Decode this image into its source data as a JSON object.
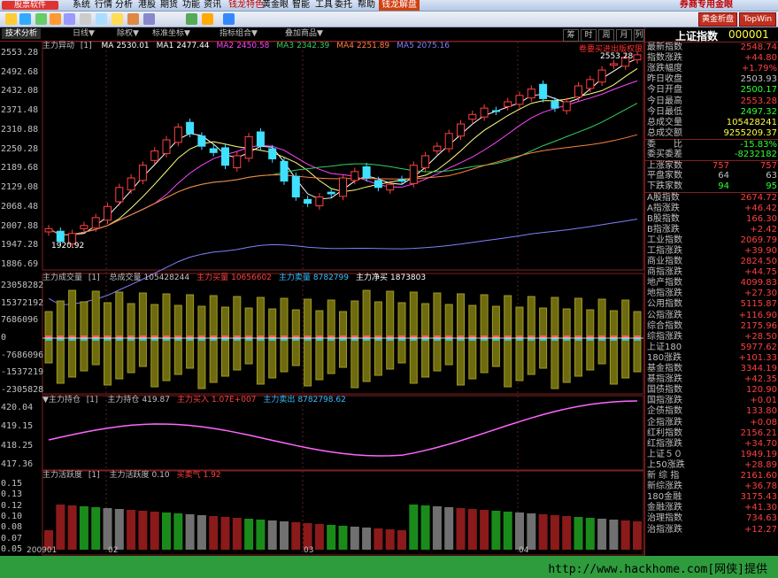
{
  "app": {
    "name": "股票软件"
  },
  "menu": [
    "系统",
    "行情",
    "分析",
    "港股",
    "期货",
    "功能",
    "资讯",
    "钱龙特色",
    "黄金眼",
    "智能",
    "工具",
    "委托",
    "帮助"
  ],
  "menu_highlight": "钱龙解盘",
  "menu_right": "券商专用金眼",
  "buttons": {
    "gold": "黄金析盘",
    "top": "TopWin"
  },
  "subbar": {
    "analysis_tab": "技术分析",
    "tabs": [
      "日线▼",
      "除权▼",
      "标准坐标▼",
      "指标组合▼",
      "叠加商品▼"
    ],
    "period_tabs": [
      "筹",
      "时",
      "周",
      "月",
      "列"
    ]
  },
  "panels": {
    "main": {
      "title": "主力异动",
      "param": "[1]",
      "ma": [
        {
          "name": "MA",
          "value": "2530.01",
          "color": "#ffffff"
        },
        {
          "name": "MA1",
          "value": "2477.44",
          "color": "#ffffff"
        },
        {
          "name": "MA2",
          "value": "2450.58",
          "color": "#ff44ff"
        },
        {
          "name": "MA3",
          "value": "2342.39",
          "color": "#30d060"
        },
        {
          "name": "MA4",
          "value": "2251.89",
          "color": "#ff8040"
        },
        {
          "name": "MA5",
          "value": "2075.16",
          "color": "#8080ff"
        }
      ],
      "yticks": [
        "2553.28",
        "2492.68",
        "2432.08",
        "2371.48",
        "2310.88",
        "2250.28",
        "2189.68",
        "2129.08",
        "2068.48",
        "2007.88",
        "1947.28",
        "1886.69"
      ],
      "annot_high": "2553.28",
      "annot_low": "1920.92",
      "signal": "卷要买进出版权限"
    },
    "volume": {
      "title": "主力成交量",
      "param": "[1]",
      "items": [
        {
          "name": "总成交量",
          "value": "105428244"
        },
        {
          "name": "主力买量",
          "value": "10656602"
        },
        {
          "name": "主力卖量",
          "value": "8782799"
        },
        {
          "name": "主力净买",
          "value": "1873803"
        }
      ],
      "yticks": [
        "23058282",
        "15372192",
        "7686096",
        "0",
        "-7686096",
        "-1537219",
        "-2305828"
      ]
    },
    "position": {
      "title": "▼主力持仓",
      "param": "[1]",
      "items": [
        {
          "name": "主力持仓",
          "value": "419.87"
        },
        {
          "name": "主力买入",
          "value": "1.07E+007"
        },
        {
          "name": "主力卖出",
          "value": "8782798.62"
        }
      ],
      "yticks": [
        "420.04",
        "419.15",
        "418.25",
        "417.36"
      ]
    },
    "activity": {
      "title": "主力活跃度",
      "param": "[1]",
      "items": [
        {
          "name": "主力活跃度",
          "value": "0.10"
        },
        {
          "name": "买卖气",
          "value": "1.92"
        }
      ],
      "yticks": [
        "0.15",
        "0.13",
        "0.12",
        "0.10",
        "0.08",
        "0.07",
        "0.05"
      ]
    }
  },
  "xaxis": [
    "200901",
    "02",
    "03",
    "04"
  ],
  "right_panel": {
    "title": "上证指数",
    "code": "000001",
    "rows": [
      {
        "label": "最新指数",
        "value": "2548.74",
        "color": "#ff4040"
      },
      {
        "label": "指数涨跌",
        "value": "+44.80",
        "color": "#ff4040"
      },
      {
        "label": "涨跌幅度",
        "value": "+1.79%",
        "color": "#ff4040"
      },
      {
        "label": "昨日收盘",
        "value": "2503.93",
        "color": "#c0c0c0"
      },
      {
        "label": "今日开盘",
        "value": "2500.17",
        "color": "#30ff30"
      },
      {
        "label": "今日最高",
        "value": "2553.28",
        "color": "#ff4040"
      },
      {
        "label": "今日最低",
        "value": "2497.32",
        "color": "#30ff30"
      },
      {
        "label": "总成交量",
        "value": "105428241",
        "color": "#ffff40"
      },
      {
        "label": "总成交额",
        "value": "9255209.37",
        "color": "#ffff40"
      },
      {
        "label": "委　　比",
        "value": "-15.83%",
        "color": "#30ff30"
      },
      {
        "label": "委买委差",
        "value": "-8232182",
        "color": "#30ff30"
      },
      {
        "label": "上涨家数",
        "v1": "757",
        "v2": "757"
      },
      {
        "label": "平盘家数",
        "v1": "64",
        "v2": "63"
      },
      {
        "label": "下跌家数",
        "v1": "94",
        "v2": "95"
      },
      {
        "label": "A股指数",
        "value": "2674.72",
        "color": "#ff4040"
      },
      {
        "label": "A指涨跌",
        "value": "+46.42",
        "color": "#ff4040"
      },
      {
        "label": "B股指数",
        "value": "166.30",
        "color": "#ff4040"
      },
      {
        "label": "B指涨跌",
        "value": "+2.42",
        "color": "#ff4040"
      },
      {
        "label": "工业指数",
        "value": "2069.79",
        "color": "#ff4040"
      },
      {
        "label": "工指涨跌",
        "value": "+39.90",
        "color": "#ff4040"
      },
      {
        "label": "商业指数",
        "value": "2824.50",
        "color": "#ff4040"
      },
      {
        "label": "商指涨跌",
        "value": "+44.75",
        "color": "#ff4040"
      },
      {
        "label": "地产指数",
        "value": "4099.83",
        "color": "#ff4040"
      },
      {
        "label": "地指涨跌",
        "value": "+27.30",
        "color": "#ff4040"
      },
      {
        "label": "公用指数",
        "value": "5115.87",
        "color": "#ff4040"
      },
      {
        "label": "公指涨跌",
        "value": "+116.90",
        "color": "#ff4040"
      },
      {
        "label": "综合指数",
        "value": "2175.96",
        "color": "#ff4040"
      },
      {
        "label": "综指涨跌",
        "value": "+28.50",
        "color": "#ff4040"
      },
      {
        "label": "上证180",
        "value": "5977.62",
        "color": "#ff4040"
      },
      {
        "label": "180涨跌",
        "value": "+101.33",
        "color": "#ff4040"
      },
      {
        "label": "基金指数",
        "value": "3344.19",
        "color": "#ff4040"
      },
      {
        "label": "基指涨跌",
        "value": "+42.35",
        "color": "#ff4040"
      },
      {
        "label": "国债指数",
        "value": "120.90",
        "color": "#ff4040"
      },
      {
        "label": "国指涨跌",
        "value": "+0.01",
        "color": "#ff4040"
      },
      {
        "label": "企债指数",
        "value": "133.80",
        "color": "#ff4040"
      },
      {
        "label": "企指涨跌",
        "value": "+0.08",
        "color": "#ff4040"
      },
      {
        "label": "红利指数",
        "value": "2156.21",
        "color": "#ff4040"
      },
      {
        "label": "红指涨跌",
        "value": "+34.70",
        "color": "#ff4040"
      },
      {
        "label": "上证５０",
        "value": "1949.19",
        "color": "#ff4040"
      },
      {
        "label": "上50涨跌",
        "value": "+28.89",
        "color": "#ff4040"
      },
      {
        "label": "新 综 指",
        "value": "2161.60",
        "color": "#ff4040"
      },
      {
        "label": "新综涨跌",
        "value": "+36.78",
        "color": "#ff4040"
      },
      {
        "label": "180金融",
        "value": "3175.43",
        "color": "#ff4040"
      },
      {
        "label": "金融涨跌",
        "value": "+41.30",
        "color": "#ff4040"
      },
      {
        "label": "治理指数",
        "value": "734.63",
        "color": "#ff4040"
      },
      {
        "label": "治指涨跌",
        "value": "+12.27",
        "color": "#ff4040"
      }
    ]
  },
  "watermark": "http://www.hackhome.com[网侠]提供",
  "chart_data": {
    "type": "candlestick",
    "candles_close_trend": [
      2000,
      1960,
      1985,
      2010,
      2035,
      2070,
      2130,
      2160,
      2200,
      2245,
      2280,
      2320,
      2300,
      2260,
      2240,
      2200,
      2230,
      2290,
      2260,
      2220,
      2150,
      2100,
      2080,
      2100,
      2110,
      2160,
      2180,
      2160,
      2130,
      2140,
      2150,
      2200,
      2230,
      2260,
      2300,
      2330,
      2360,
      2380,
      2370,
      2400,
      2420,
      2440,
      2410,
      2380,
      2400,
      2450,
      2470,
      2500,
      2520,
      2540,
      2548
    ]
  }
}
